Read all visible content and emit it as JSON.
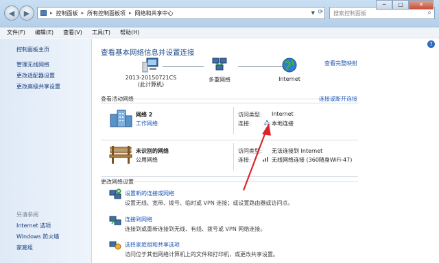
{
  "address": {
    "crumbs": [
      "控制面板",
      "所有控制面板项",
      "网络和共享中心"
    ],
    "search_placeholder": "搜索控制面板"
  },
  "window_controls": {
    "minimize": "─",
    "maximize": "□",
    "close": "✕"
  },
  "menu": [
    "文件(F)",
    "编辑(E)",
    "查看(V)",
    "工具(T)",
    "帮助(H)"
  ],
  "left_pane": {
    "home": "控制面板主页",
    "tasks": [
      "管理无线网络",
      "更改适配器设置",
      "更改高级共享设置"
    ],
    "see_also_title": "另请参阅",
    "see_also": [
      "Internet 选项",
      "Windows 防火墙",
      "家庭组"
    ]
  },
  "main": {
    "title": "查看基本网络信息并设置连接",
    "full_map": "查看完整映射",
    "map": {
      "computer_name": "2013-20150721CS",
      "computer_sub": "(此计算机)",
      "multi_network": "多重网络",
      "internet": "Internet"
    },
    "active_title": "查看活动网络",
    "connect_link": "连接或断开连接",
    "networks": [
      {
        "name": "网络  2",
        "type": "工作网络",
        "access_key": "访问类型:",
        "access_val": "Internet",
        "conn_key": "连接:",
        "conn_val": "本地连接"
      },
      {
        "name": "未识别的网络",
        "type": "公用网络",
        "access_key": "访问类型:",
        "access_val": "无法连接到 Internet",
        "conn_key": "连接:",
        "conn_val": "无线网络连接 (360随身WiFi-47)"
      }
    ],
    "change_title": "更改网络设置",
    "changes": [
      {
        "link": "设置新的连接或网络",
        "desc": "设置无线、宽带、拨号、临时或 VPN 连接；或设置路由器或访问点。"
      },
      {
        "link": "连接到网络",
        "desc": "连接到或重新连接到无线、有线、拨号或 VPN 网络连接。"
      },
      {
        "link": "选择家庭组和共享选项",
        "desc": "访问位于其他网络计算机上的文件和打印机，或更改共享设置。"
      }
    ]
  },
  "colors": {
    "link": "#1f58b5",
    "title": "#1c4a8a",
    "arrow": "#d9262c"
  }
}
